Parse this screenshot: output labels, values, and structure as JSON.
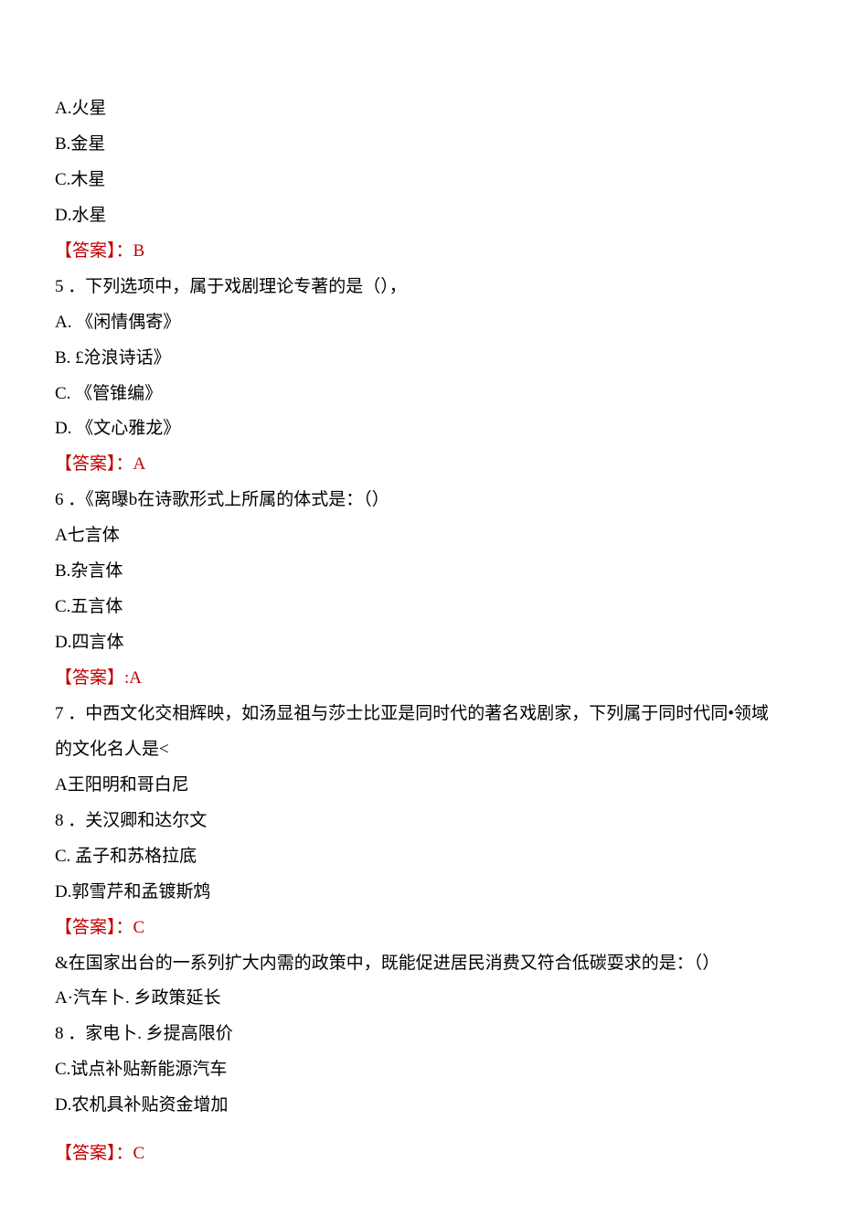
{
  "q4": {
    "optA": "A.火星",
    "optB": "B.金星",
    "optC": "C.木星",
    "optD": "D.水星",
    "ansLabel": "【答案】：",
    "ansVal": "B"
  },
  "q5": {
    "stem": "5 ．下列选项中，属于戏剧理论专著的是（），",
    "optA": "A. 《闲情偶寄》",
    "optB": "B.    £沧浪诗话》",
    "optC": "C. 《管锥编》",
    "optD": "D. 《文心雅龙》",
    "ansLabel": "【答案】：",
    "ansVal": "A"
  },
  "q6": {
    "stem": "6 ．《离曝b在诗歌形式上所属的体式是：（）",
    "optA": "A七言体",
    "optB": "B.杂言体",
    "optC": "C.五言体",
    "optD": "D.四言体",
    "ansLabel": "【答案】",
    "ansVal": ":A"
  },
  "q7": {
    "stem1": "7 ．中西文化交相辉映，如汤显祖与莎士比亚是同时代的著名戏剧家，下列属于同时代同•领域",
    "stem2": "的文化名人是<",
    "optA": "A王阳明和哥白尼",
    "optB": "8 ．关汉卿和达尔文",
    "optC": "C.   孟子和苏格拉底",
    "optD": "D.郭雪芹和孟镀斯鸩",
    "ansLabel": "【答案】：",
    "ansVal": "C"
  },
  "q8": {
    "stem": "&在国家出台的一系列扩大内需的政策中，既能促进居民消费又符合低碳耍求的是：（）",
    "optA": "A·汽车卜. 乡政策延长",
    "optB": "8   ．家电卜. 乡提高限价",
    "optC": "C.试点补贴新能源汽车",
    "optD": "D.农机具补贴资金增加",
    "ansLabel": "【答案】：",
    "ansVal": "C"
  }
}
